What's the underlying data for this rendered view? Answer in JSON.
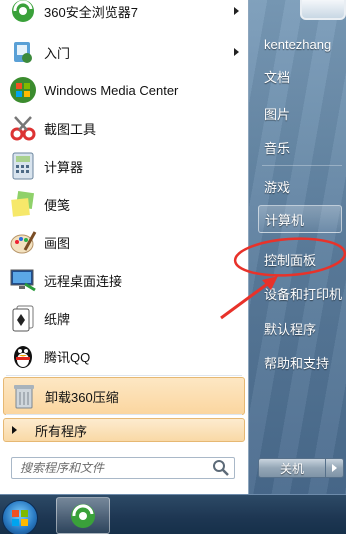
{
  "programs": [
    {
      "label": "360安全浏览器7",
      "icon": "360-browser-icon",
      "has_submenu": true
    },
    {
      "label": "入门",
      "icon": "getting-started-icon",
      "has_submenu": true
    },
    {
      "label": "Windows Media Center",
      "icon": "windows-media-center-icon",
      "has_submenu": false
    },
    {
      "label": "截图工具",
      "icon": "snipping-tool-icon",
      "has_submenu": false
    },
    {
      "label": "计算器",
      "icon": "calculator-icon",
      "has_submenu": false
    },
    {
      "label": "便笺",
      "icon": "sticky-notes-icon",
      "has_submenu": false
    },
    {
      "label": "画图",
      "icon": "paint-icon",
      "has_submenu": false
    },
    {
      "label": "远程桌面连接",
      "icon": "remote-desktop-icon",
      "has_submenu": false
    },
    {
      "label": "纸牌",
      "icon": "solitaire-icon",
      "has_submenu": false
    },
    {
      "label": "腾讯QQ",
      "icon": "qq-penguin-icon",
      "has_submenu": false
    },
    {
      "label": "卸载360压缩",
      "icon": "uninstall-360-zip-icon",
      "has_submenu": false,
      "highlighted": true
    }
  ],
  "all_programs": "所有程序",
  "search": {
    "placeholder": "搜索程序和文件"
  },
  "right_menu": [
    {
      "label": "kentezhang"
    },
    {
      "label": "文档"
    },
    {
      "label": "图片"
    },
    {
      "label": "音乐"
    },
    {
      "label": "游戏"
    },
    {
      "label": "计算机"
    },
    {
      "label": "控制面板"
    },
    {
      "label": "设备和打印机"
    },
    {
      "label": "默认程序"
    },
    {
      "label": "帮助和支持"
    }
  ],
  "shutdown": {
    "label": "关机"
  },
  "colors": {
    "annotation": "#e8322a",
    "highlight": "#fbd6a0"
  }
}
